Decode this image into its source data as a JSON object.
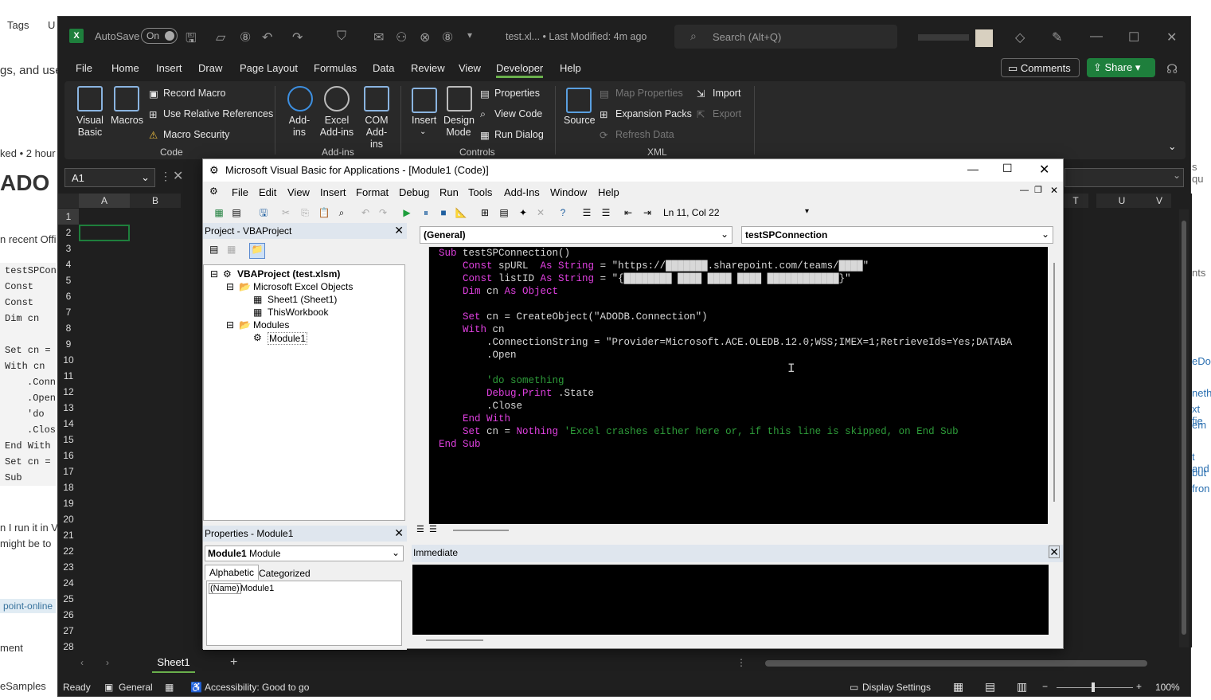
{
  "background_page": {
    "tags": "Tags",
    "u": "U",
    "line_text": "gs, and use",
    "asked": "ked • 2 hour",
    "heading": "ADO",
    "recent": "n recent Offi",
    "code_lines": [
      "testSPConn",
      "Const spUR",
      "Const list",
      "Dim cn As",
      "",
      "Set cn = C",
      "With cn",
      ".Conne",
      ".Open",
      "'do so",
      ".Close",
      "End With",
      "Set cn = N",
      "Sub"
    ],
    "run_text": "n I run it in V",
    "might_text": "might be to",
    "tag": "point-online",
    "comment": "ment",
    "samples": "eSamples",
    "right_text": [
      "s qu",
      "nts",
      "eDoc",
      "neth",
      "xt fie",
      "em",
      "t and",
      "but",
      "fron"
    ]
  },
  "excel": {
    "autosave_label": "AutoSave",
    "autosave_state": "On",
    "file_title": "test.xl... • Last Modified: 4m ago",
    "search_placeholder": "Search (Alt+Q)",
    "menu_tabs": [
      "File",
      "Home",
      "Insert",
      "Draw",
      "Page Layout",
      "Formulas",
      "Data",
      "Review",
      "View",
      "Developer",
      "Help"
    ],
    "active_tab": "Developer",
    "comments_label": "Comments",
    "share_label": "Share",
    "ribbon": {
      "visual_basic": "Visual Basic",
      "macros": "Macros",
      "record_macro": "Record Macro",
      "use_relative": "Use Relative References",
      "macro_security": "Macro Security",
      "group_code": "Code",
      "add_ins": "Add-ins",
      "excel_add_ins": "Excel Add-ins",
      "com_add_ins": "COM Add-ins",
      "group_addins": "Add-ins",
      "insert": "Insert",
      "design_mode": "Design Mode",
      "properties": "Properties",
      "view_code": "View Code",
      "run_dialog": "Run Dialog",
      "group_controls": "Controls",
      "source": "Source",
      "map_properties": "Map Properties",
      "expansion_packs": "Expansion Packs",
      "refresh_data": "Refresh Data",
      "import": "Import",
      "export": "Export",
      "group_xml": "XML"
    },
    "name_box": "A1",
    "columns": [
      "A",
      "B",
      "T",
      "U",
      "V"
    ],
    "rows": [
      "1",
      "2",
      "3",
      "4",
      "5",
      "6",
      "7",
      "8",
      "9",
      "10",
      "11",
      "12",
      "13",
      "14",
      "15",
      "16",
      "17",
      "18",
      "19",
      "20",
      "21",
      "22",
      "23",
      "24",
      "25",
      "26",
      "27",
      "28"
    ],
    "sheet_tab": "Sheet1",
    "status": {
      "ready": "Ready",
      "general": "General",
      "accessibility": "Accessibility: Good to go",
      "display_settings": "Display Settings",
      "zoom": "100%"
    }
  },
  "vba": {
    "title": "Microsoft Visual Basic for Applications - [Module1 (Code)]",
    "menu": [
      "File",
      "Edit",
      "View",
      "Insert",
      "Format",
      "Debug",
      "Run",
      "Tools",
      "Add-Ins",
      "Window",
      "Help"
    ],
    "cursor_pos": "Ln 11, Col 22",
    "project_title": "Project - VBAProject",
    "tree": {
      "root": "VBAProject (test.xlsm)",
      "excel_objects": "Microsoft Excel Objects",
      "sheet1": "Sheet1 (Sheet1)",
      "workbook": "ThisWorkbook",
      "modules": "Modules",
      "module1": "Module1"
    },
    "properties_title": "Properties - Module1",
    "properties_object": "Module1",
    "properties_type": "Module",
    "properties_tabs": [
      "Alphabetic",
      "Categorized"
    ],
    "properties_name_key": "(Name)",
    "properties_name_value": "Module1",
    "object_dropdown": "(General)",
    "procedure_dropdown": "testSPConnection",
    "immediate_title": "Immediate",
    "code": {
      "l1_kw": "Sub",
      "l1": " testSPConnection()",
      "l2_kw": "Const",
      "l2a": " spURL  ",
      "l2_kw2": "As String",
      "l2b": " = \"https://███████.sharepoint.com/teams/████\"",
      "l3_kw": "Const",
      "l3a": " listID ",
      "l3_kw2": "As String",
      "l3b": " = \"{████████ ████ ████ ████ ████████████}\"",
      "l4_kw": "Dim",
      "l4a": " cn ",
      "l4_kw2": "As Object",
      "l6_kw": "Set",
      "l6": " cn = CreateObject(\"ADODB.Connection\")",
      "l7_kw": "With",
      "l7": " cn",
      "l8": "    .ConnectionString = \"Provider=Microsoft.ACE.OLEDB.12.0;WSS;IMEX=1;RetrieveIds=Yes;DATABA",
      "l9": "    .Open",
      "l11": "    'do something",
      "l12_kw": "    Debug.Print",
      "l12": " .State",
      "l13": "    .Close",
      "l14_kw": "End With",
      "l15_kw": "Set",
      "l15a": " cn = ",
      "l15_kw2": "Nothing",
      "l15_cm": " 'Excel crashes either here or, if this line is skipped, on End Sub",
      "l16_kw": "End Sub"
    }
  },
  "colors": {
    "excel_bg": "#1f1f1f",
    "ribbon_bg": "#292929",
    "share_green": "#1e7f3c",
    "vba_keyword": "#e040e0",
    "vba_comment": "#2e9d3a"
  }
}
